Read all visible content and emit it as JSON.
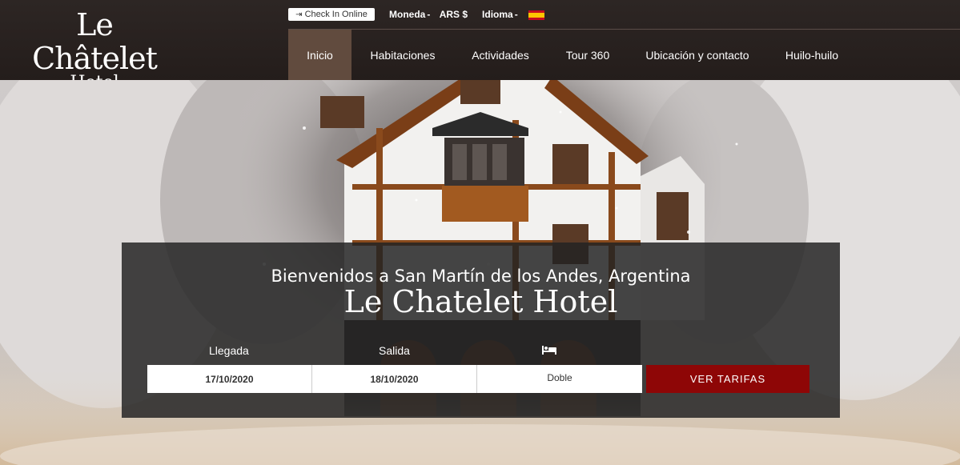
{
  "logo": {
    "line1": "Le Châtelet",
    "line2": "Hotel"
  },
  "topbar": {
    "checkin_label": "Check In Online",
    "moneda_label": "Moneda",
    "moneda_value": "ARS $",
    "idioma_label": "Idioma"
  },
  "nav": {
    "items": [
      {
        "label": "Inicio"
      },
      {
        "label": "Habitaciones"
      },
      {
        "label": "Actividades"
      },
      {
        "label": "Tour 360"
      },
      {
        "label": "Ubicación y contacto"
      },
      {
        "label": "Huilo-huilo"
      }
    ],
    "active_color": "#614b3e"
  },
  "booking": {
    "welcome": "Bienvenidos a San Martín de los Andes, Argentina",
    "hotel_name": "Le Chatelet Hotel",
    "llegada_label": "Llegada",
    "salida_label": "Salida",
    "llegada_value": "17/10/2020",
    "salida_value": "18/10/2020",
    "room_value": "Doble",
    "button_label": "VER TARIFAS",
    "button_color": "#8e0606"
  },
  "icons": [
    "sign-in-icon",
    "spain-flag-icon",
    "bed-icon"
  ]
}
